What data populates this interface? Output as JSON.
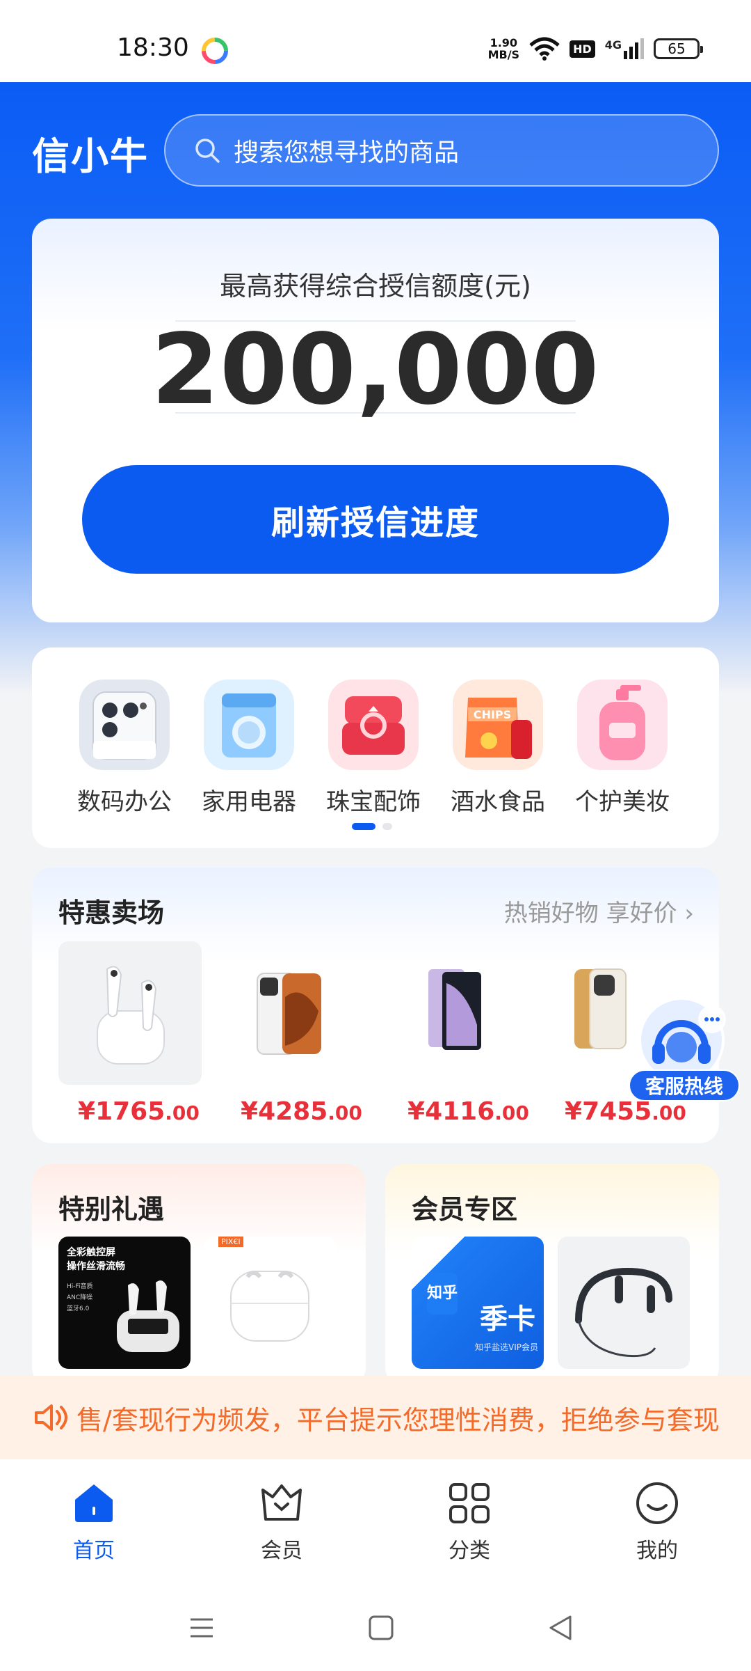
{
  "status": {
    "time": "18:30",
    "net_speed_value": "1.90",
    "net_speed_unit": "MB/S",
    "hd": "HD",
    "signal": "4G",
    "battery": "65"
  },
  "header": {
    "brand": "信小牛",
    "search_placeholder": "搜索您想寻找的商品"
  },
  "credit": {
    "label": "最高获得综合授信额度(元)",
    "amount": "200,000",
    "button": "刷新授信进度"
  },
  "categories": [
    {
      "label": "数码办公",
      "icon": "phone-camera-icon"
    },
    {
      "label": "家用电器",
      "icon": "washing-machine-icon"
    },
    {
      "label": "珠宝配饰",
      "icon": "ring-box-icon"
    },
    {
      "label": "酒水食品",
      "icon": "chips-snack-icon"
    },
    {
      "label": "个护美妆",
      "icon": "lotion-bottle-icon"
    }
  ],
  "deals": {
    "title": "特惠卖场",
    "more": "热销好物 享好价",
    "products": [
      {
        "symbol": "¥",
        "integer": "1765",
        "cents": ".00",
        "icon": "earbuds-icon"
      },
      {
        "symbol": "¥",
        "integer": "4285",
        "cents": ".00",
        "icon": "phone-icon"
      },
      {
        "symbol": "¥",
        "integer": "4116",
        "cents": ".00",
        "icon": "tablet-icon"
      },
      {
        "symbol": "¥",
        "integer": "7455",
        "cents": ".00",
        "icon": "phone-gold-icon"
      }
    ]
  },
  "customer_service": {
    "label": "客服热线"
  },
  "special": {
    "title": "特别礼遇",
    "promo_line1": "全彩触控屏",
    "promo_line2": "操作丝滑流畅",
    "promo_bullets": [
      "Hi-Fi音质",
      "ANC降噪",
      "蓝牙6.0"
    ],
    "brand_tag": "PIX€I"
  },
  "member": {
    "title": "会员专区",
    "zhihu_logo": "知乎",
    "zhihu_card": "季卡",
    "zhihu_caption": "知乎盐选VIP会员"
  },
  "notice": {
    "text": "售/套现行为频发，平台提示您理性消费，拒绝参与套现"
  },
  "tabs": [
    {
      "label": "首页",
      "active": true
    },
    {
      "label": "会员",
      "active": false
    },
    {
      "label": "分类",
      "active": false
    },
    {
      "label": "我的",
      "active": false
    }
  ],
  "colors": {
    "primary": "#0b5bf0",
    "price": "#e8303a",
    "notice": "#f36b2b"
  }
}
